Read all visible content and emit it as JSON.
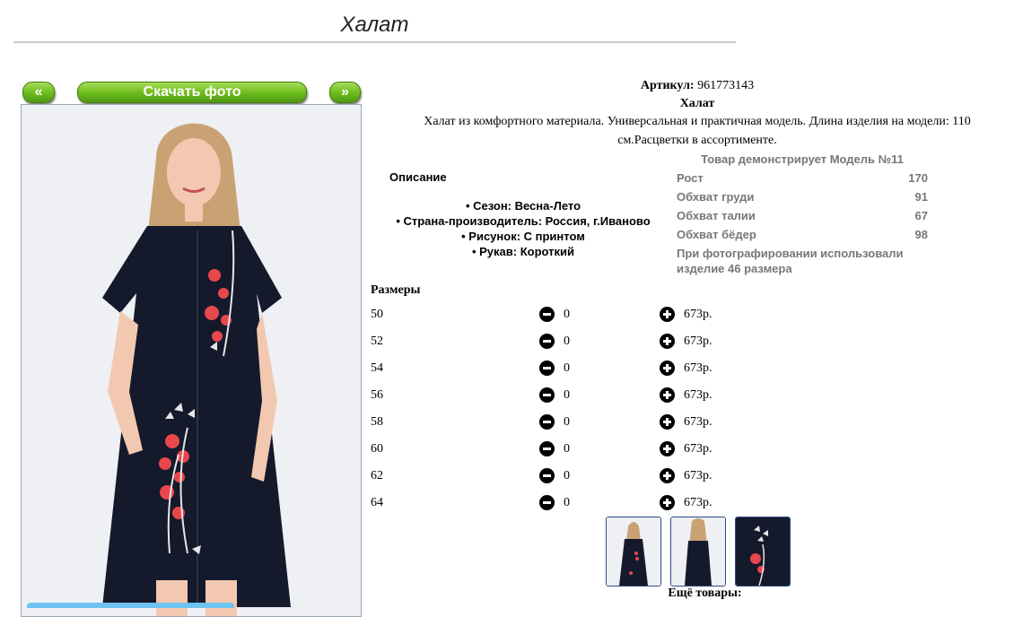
{
  "page": {
    "title": "Халат"
  },
  "gallery": {
    "prev_label": "«",
    "download_label": "Скачать фото",
    "next_label": "»",
    "thumbnails": [
      "front-view",
      "back-view",
      "print-detail"
    ]
  },
  "product": {
    "article_label": "Артикул:",
    "article_value": "961773143",
    "name": "Халат",
    "description_line1": "Халат из комфортного материала. Универсальная и практичная модель. Длина изделия на модели: 110",
    "description_line2": "см.Расцветки в ассортименте."
  },
  "specs": {
    "heading": "Описание",
    "items": [
      "Сезон: Весна-Лето",
      "Страна-производитель: Россия, г.Иваново",
      "Рисунок: С принтом",
      "Рукав: Короткий"
    ]
  },
  "model": {
    "heading": "Товар демонстрирует Модель №11",
    "measurements": [
      {
        "label": "Рост",
        "value": "170"
      },
      {
        "label": "Обхват груди",
        "value": "91"
      },
      {
        "label": "Обхват талии",
        "value": "67"
      },
      {
        "label": "Обхват бёдер",
        "value": "98"
      }
    ],
    "note_line1": "При фотографировании использовали",
    "note_line2": "изделие 46 размера"
  },
  "sizes": {
    "heading": "Размеры",
    "rows": [
      {
        "size": "50",
        "qty": "0",
        "price": "673р."
      },
      {
        "size": "52",
        "qty": "0",
        "price": "673р."
      },
      {
        "size": "54",
        "qty": "0",
        "price": "673р."
      },
      {
        "size": "56",
        "qty": "0",
        "price": "673р."
      },
      {
        "size": "58",
        "qty": "0",
        "price": "673р."
      },
      {
        "size": "60",
        "qty": "0",
        "price": "673р."
      },
      {
        "size": "62",
        "qty": "0",
        "price": "673р."
      },
      {
        "size": "64",
        "qty": "0",
        "price": "673р."
      }
    ]
  },
  "more": {
    "heading": "Ещё товары:"
  },
  "colors": {
    "accent_green": "#6fbe1e",
    "thumb_border": "#2b4c7e",
    "dress": "#141a2b",
    "flower": "#e8474c"
  }
}
